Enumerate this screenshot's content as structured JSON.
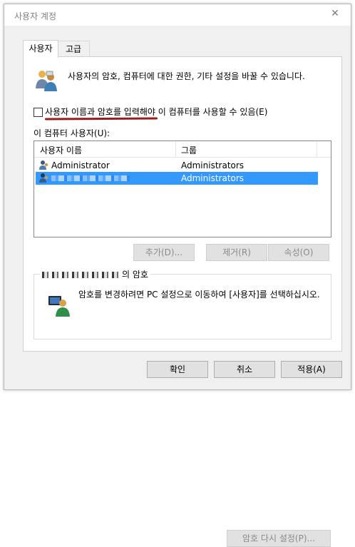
{
  "window": {
    "title": "사용자 계정",
    "close_glyph": "✕"
  },
  "tabs": [
    {
      "label": "사용자"
    },
    {
      "label": "고급"
    }
  ],
  "description": "사용자의 암호, 컴퓨터에 대한 권한, 기타 설정을 바꿀 수 있습니다.",
  "require_login": {
    "checked": false,
    "label": "사용자 이름과 암호를 입력해야 이 컴퓨터를 사용할 수 있음(E)"
  },
  "users_list": {
    "label": "이 컴퓨터 사용자(U):",
    "columns": [
      "사용자 이름",
      "그룹"
    ],
    "rows": [
      {
        "name": "Administrator",
        "group": "Administrators",
        "selected": false
      },
      {
        "name": "",
        "group": "Administrators",
        "selected": true
      }
    ]
  },
  "buttons": {
    "add": "추가(D)...",
    "remove": "제거(R)",
    "properties": "속성(O)"
  },
  "password_group": {
    "title_suffix": "의 암호",
    "text": "암호를 변경하려면 PC 설정으로 이동하여 [사용자]를 선택하십시오.",
    "reset_button": "암호 다시 설정(P)..."
  },
  "footer": {
    "ok": "확인",
    "cancel": "취소",
    "apply": "적용(A)"
  },
  "colors": {
    "selection": "#3399ff",
    "annotation_underline": "#9b1c1c"
  }
}
